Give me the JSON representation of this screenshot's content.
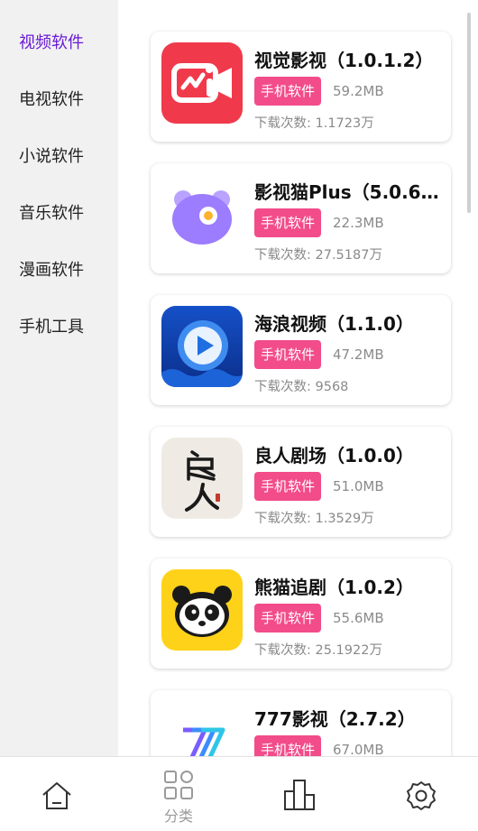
{
  "sidebar": {
    "items": [
      {
        "label": "视频软件",
        "active": true
      },
      {
        "label": "电视软件",
        "active": false
      },
      {
        "label": "小说软件",
        "active": false
      },
      {
        "label": "音乐软件",
        "active": false
      },
      {
        "label": "漫画软件",
        "active": false
      },
      {
        "label": "手机工具",
        "active": false
      }
    ]
  },
  "apps": [
    {
      "title": "视觉影视（1.0.1.2）",
      "tag": "手机软件",
      "size": "59.2MB",
      "downloads": "下载次数: 1.1723万",
      "icon": "video-camera-icon"
    },
    {
      "title": "影视猫Plus（5.0.6.…",
      "tag": "手机软件",
      "size": "22.3MB",
      "downloads": "下载次数: 27.5187万",
      "icon": "cat-face-icon"
    },
    {
      "title": "海浪视频（1.1.0）",
      "tag": "手机软件",
      "size": "47.2MB",
      "downloads": "下载次数: 9568",
      "icon": "play-button-icon"
    },
    {
      "title": "良人剧场（1.0.0）",
      "tag": "手机软件",
      "size": "51.0MB",
      "downloads": "下载次数: 1.3529万",
      "icon": "calligraphy-icon"
    },
    {
      "title": "熊猫追剧（1.0.2）",
      "tag": "手机软件",
      "size": "55.6MB",
      "downloads": "下载次数: 25.1922万",
      "icon": "panda-icon"
    },
    {
      "title": "777影视（2.7.2）",
      "tag": "手机软件",
      "size": "67.0MB",
      "downloads": "",
      "icon": "seven-logo-icon"
    }
  ],
  "bottom_nav": {
    "items": [
      {
        "label": "",
        "icon": "home-icon"
      },
      {
        "label": "分类",
        "icon": "category-grid-icon"
      },
      {
        "label": "",
        "icon": "ranking-icon"
      },
      {
        "label": "",
        "icon": "settings-icon"
      }
    ]
  },
  "colors": {
    "accent": "#6a1ad6",
    "tag": "#f24c8a",
    "sidebar_bg": "#f1f1f1"
  }
}
